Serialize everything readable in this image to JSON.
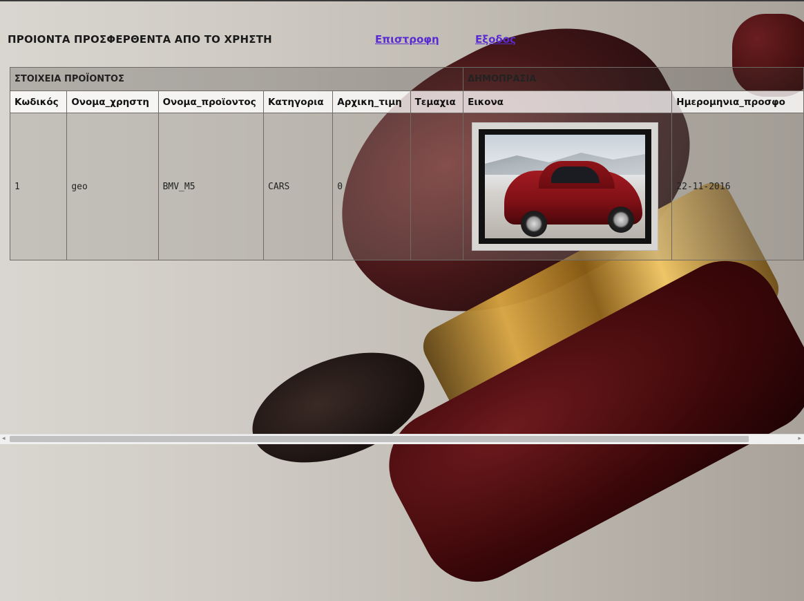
{
  "page": {
    "heading": "ΠΡΟΙΟΝΤΑ ΠΡΟΣΦΕΡΘΕΝΤΑ ΑΠΟ ΤΟ ΧΡΗΣΤΗ",
    "nav": {
      "back_label": "Επιστροφη",
      "logout_label": "Εξοδος"
    }
  },
  "table": {
    "groups": [
      "ΣΤΟΙΧΕΙΑ ΠΡΟΪΟΝΤΟΣ",
      "ΔΗΜΟΠΡΑΣΙΑ"
    ],
    "columns": [
      "Κωδικός",
      "Ονομα_χρηστη",
      "Ονομα_προϊοντος",
      "Κατηγορια",
      "Αρχικη_τιμη",
      "Τεμαχια",
      "Εικονα",
      "Ημερομηνια_προσφο"
    ],
    "rows": [
      {
        "id": "1",
        "user": "geo",
        "product": "BMV_M5",
        "category": "CARS",
        "start_price": "0",
        "pieces": "",
        "image_icon": "red-sports-car-photo",
        "date": "22-11-2016"
      }
    ]
  },
  "colors": {
    "link": "#5a2bd0",
    "heading": "#1a1a1a"
  },
  "scrollbar": {
    "left_arrow": "◂",
    "right_arrow": "▸"
  }
}
